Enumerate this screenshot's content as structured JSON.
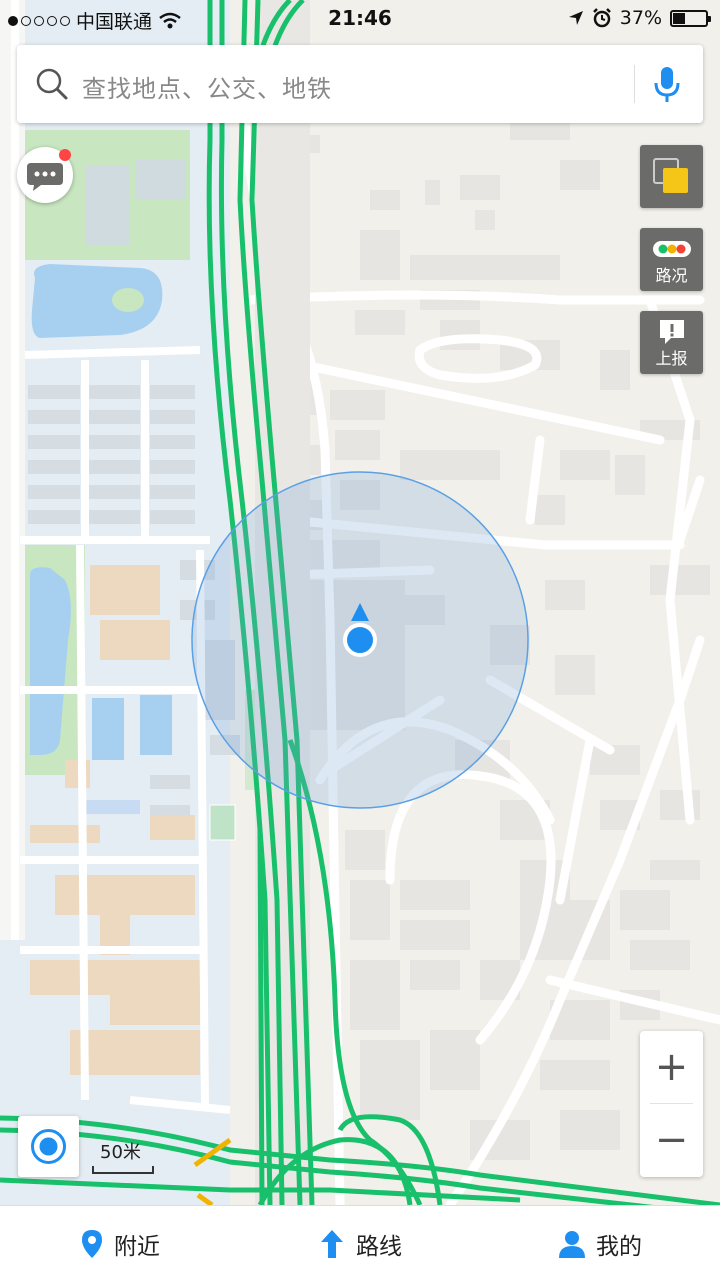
{
  "status_bar": {
    "carrier": "中国联通",
    "time": "21:46",
    "battery": "37%",
    "battery_level": 0.37
  },
  "search": {
    "placeholder": "查找地点、公交、地铁"
  },
  "side_buttons": {
    "traffic_label": "路况",
    "report_label": "上报"
  },
  "zoom": {
    "in_label": "+",
    "out_label": "−"
  },
  "scale": {
    "label": "50米"
  },
  "tabbar": {
    "items": [
      {
        "label": "附近",
        "icon": "location-pin-icon"
      },
      {
        "label": "路线",
        "icon": "route-arrow-icon"
      },
      {
        "label": "我的",
        "icon": "user-icon"
      }
    ]
  },
  "colors": {
    "accent": "#1e8ef0",
    "road_flow": "#19c06b",
    "road_warn": "#f2b300",
    "campus": "#e4edf3",
    "park": "#c8e6c0",
    "water": "#a7d0f0",
    "building_tan": "#ecd9c0",
    "map_background": "#f2f0ea"
  }
}
